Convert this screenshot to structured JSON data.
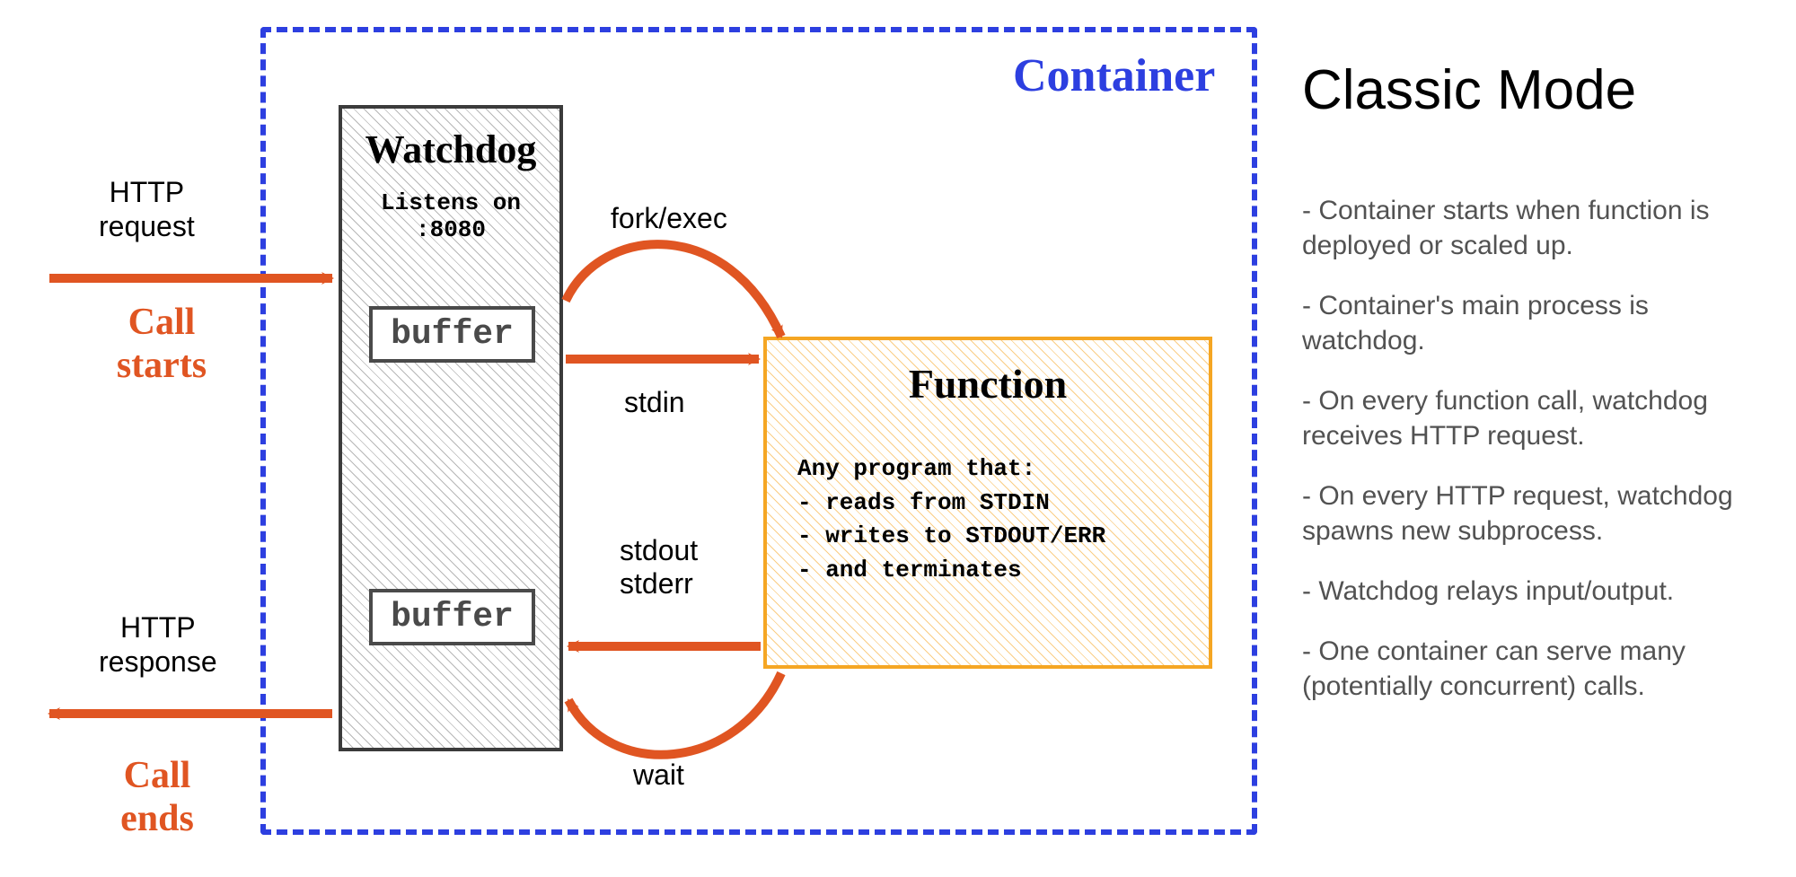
{
  "diagram": {
    "container_label": "Container",
    "watchdog": {
      "title": "Watchdog",
      "subtitle": "Listens on :8080",
      "buffer_in_label": "buffer",
      "buffer_out_label": "buffer"
    },
    "function": {
      "title": "Function",
      "desc_header": "Any program that:",
      "desc_lines": [
        "- reads from STDIN",
        "- writes to STDOUT/ERR",
        "- and terminates"
      ]
    },
    "arrows": {
      "http_request": "HTTP request",
      "call_starts": "Call starts",
      "http_response": "HTTP response",
      "call_ends": "Call ends",
      "fork_exec": "fork/exec",
      "stdin": "stdin",
      "stdout_stderr_line1": "stdout",
      "stdout_stderr_line2": "stderr",
      "wait": "wait"
    }
  },
  "panel": {
    "title": "Classic Mode",
    "bullets": [
      "Container starts when function is deployed or scaled up.",
      "Container's main process is watchdog.",
      "On every function call, watchdog receives HTTP request.",
      "On every HTTP request, watchdog spawns new subprocess.",
      "Watchdog relays input/output.",
      "One container can serve many (potentially concurrent) calls."
    ]
  },
  "colors": {
    "orange": "#e05522",
    "blue": "#2d3fe0",
    "amber": "#f5a623",
    "gray": "#4a4a4a"
  }
}
